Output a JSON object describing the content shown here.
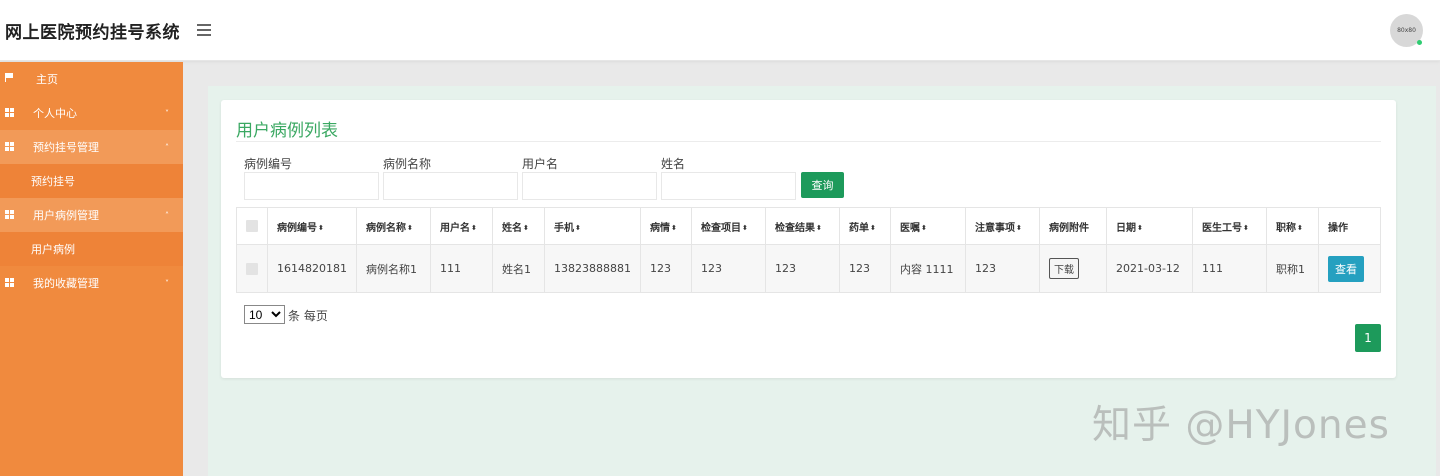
{
  "app": {
    "title": "网上医院预约挂号系统",
    "avatar_text": "80x80"
  },
  "sidebar": {
    "items": [
      {
        "label": "主页",
        "icon": "flag-icon"
      },
      {
        "label": "个人中心",
        "icon": "grid-icon",
        "arrow": "˅"
      },
      {
        "label": "预约挂号管理",
        "icon": "grid-icon",
        "arrow": "˄"
      },
      {
        "label": "预约挂号"
      },
      {
        "label": "用户病例管理",
        "icon": "grid-icon",
        "arrow": "˄"
      },
      {
        "label": "用户病例"
      },
      {
        "label": "我的收藏管理",
        "icon": "grid-icon",
        "arrow": "˅"
      }
    ]
  },
  "main": {
    "title": "用户病例列表",
    "filters": [
      {
        "label": "病例编号",
        "value": ""
      },
      {
        "label": "病例名称",
        "value": ""
      },
      {
        "label": "用户名",
        "value": ""
      },
      {
        "label": "姓名",
        "value": ""
      }
    ],
    "search_label": "查询",
    "table": {
      "columns": [
        "病例编号",
        "病例名称",
        "用户名",
        "姓名",
        "手机",
        "病情",
        "检查项目",
        "检查结果",
        "药单",
        "医嘱",
        "注意事项",
        "病例附件",
        "日期",
        "医生工号",
        "职称",
        "操作"
      ],
      "rows": [
        {
          "case_no": "1614820181",
          "case_name": "病例名称1",
          "username": "111",
          "name": "姓名1",
          "phone": "13823888881",
          "condition": "123",
          "exam_items": "123",
          "exam_results": "123",
          "prescription": "123",
          "advice": "内容 1111",
          "notes": "123",
          "attachment_btn": "下载",
          "date": "2021-03-12",
          "doctor_id": "111",
          "title": "职称1",
          "view_btn": "查看"
        }
      ]
    },
    "pagination": {
      "page_size": "10",
      "page_size_label": "条 每页",
      "current_page": "1"
    }
  },
  "watermark": "知乎 @HYJones",
  "colors": {
    "sidebar": "#f08a3e",
    "accent_green": "#1d9a5b",
    "title_green": "#3aa862",
    "view_button": "#25a0c0"
  }
}
